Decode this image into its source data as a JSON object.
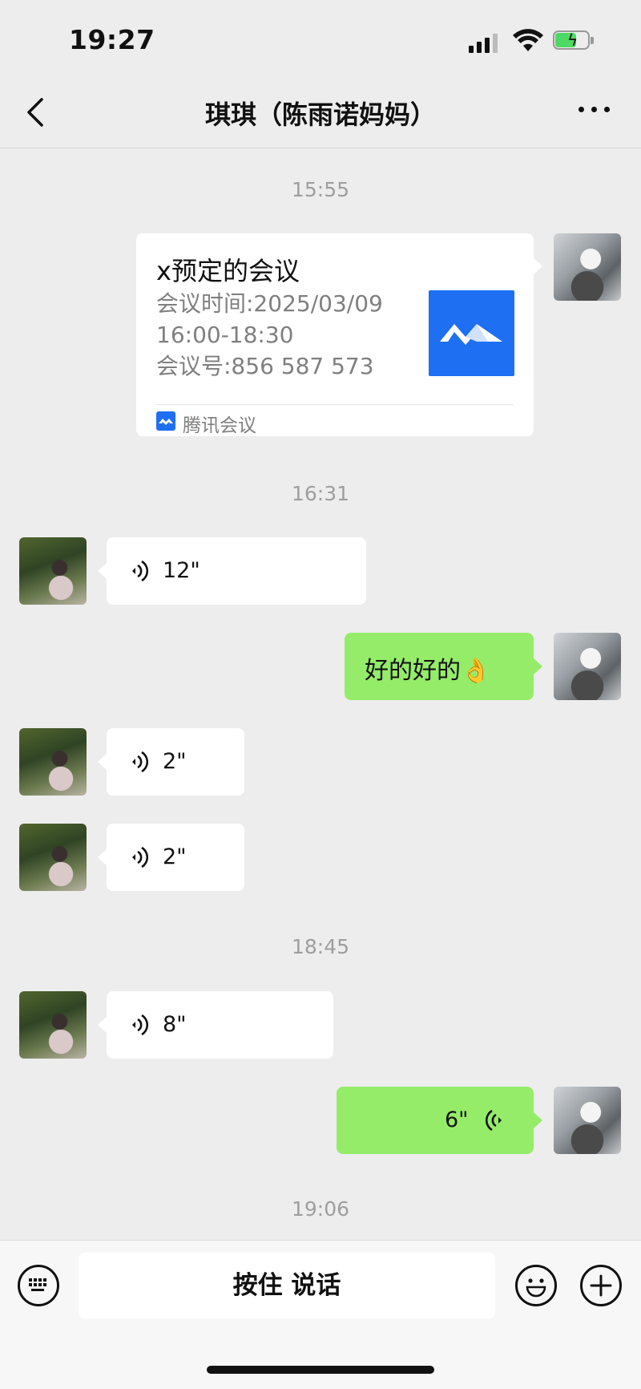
{
  "status_bar": {
    "time": "19:27"
  },
  "nav": {
    "title": "琪琪（陈雨诺妈妈）"
  },
  "messages": {
    "ts1": "15:55",
    "meeting_card": {
      "title": "x预定的会议",
      "time_line": "会议时间:2025/03/09",
      "time_range": "16:00-18:30",
      "number_line": "会议号:856 587 573",
      "footer": "腾讯会议"
    },
    "ts2": "16:31",
    "voice1": "12\"",
    "text1": "好的好的👌",
    "voice2": "2\"",
    "voice3": "2\"",
    "ts3": "18:45",
    "voice4": "8\"",
    "voice5": "6\"",
    "ts4": "19:06"
  },
  "input_bar": {
    "talk_label": "按住 说话"
  },
  "colors": {
    "green_bubble": "#95ec69",
    "background": "#ededed",
    "tencent_meeting_blue": "#1e6ff2"
  }
}
